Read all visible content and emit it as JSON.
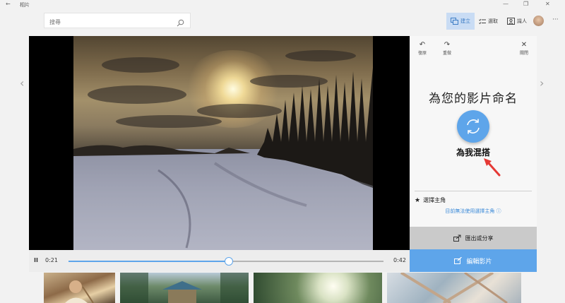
{
  "titlebar": {
    "back": "←",
    "app_title": "相片",
    "minimize": "—",
    "restore": "❐",
    "close": "✕"
  },
  "search": {
    "placeholder": "搜尋"
  },
  "nav": {
    "create": "建立",
    "select": "選取",
    "people": "識人",
    "more": "···"
  },
  "video": {
    "playing": true,
    "pause_glyph": "II",
    "current_time": "0:21",
    "total_time": "0:42",
    "progress": 0.51
  },
  "panel": {
    "undo": "復原",
    "redo": "重做",
    "close": "關閉",
    "title": "為您的影片命名",
    "remix_label": "為我混搭",
    "star_glyph": "★",
    "star_label": "選擇主角",
    "hint": "目前無法使用選擇主角 ⓘ",
    "share": "匯出或分享",
    "edit": "編輯影片"
  },
  "nav_arrows": {
    "prev": "‹",
    "next": "›"
  },
  "colors": {
    "accent": "#5ea5ea",
    "active_nav_bg": "#c9dcf4",
    "link": "#3b8ad8",
    "pointer": "#e53935"
  }
}
